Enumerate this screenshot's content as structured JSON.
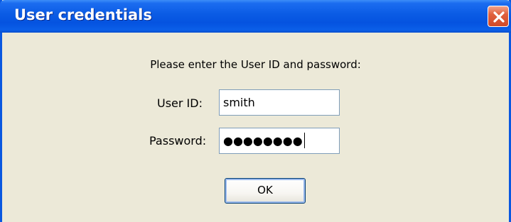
{
  "window": {
    "title": "User credentials"
  },
  "dialog": {
    "prompt": "Please enter the User ID and password:",
    "user_id_label": "User ID:",
    "user_id_value": "smith",
    "password_label": "Password:",
    "password_masked": "●●●●●●●●",
    "ok_label": "OK"
  },
  "colors": {
    "titlebar": "#0a5be4",
    "window_bg": "#ece9d8",
    "close_button": "#e0603d"
  },
  "icons": {
    "close": "close-icon"
  }
}
